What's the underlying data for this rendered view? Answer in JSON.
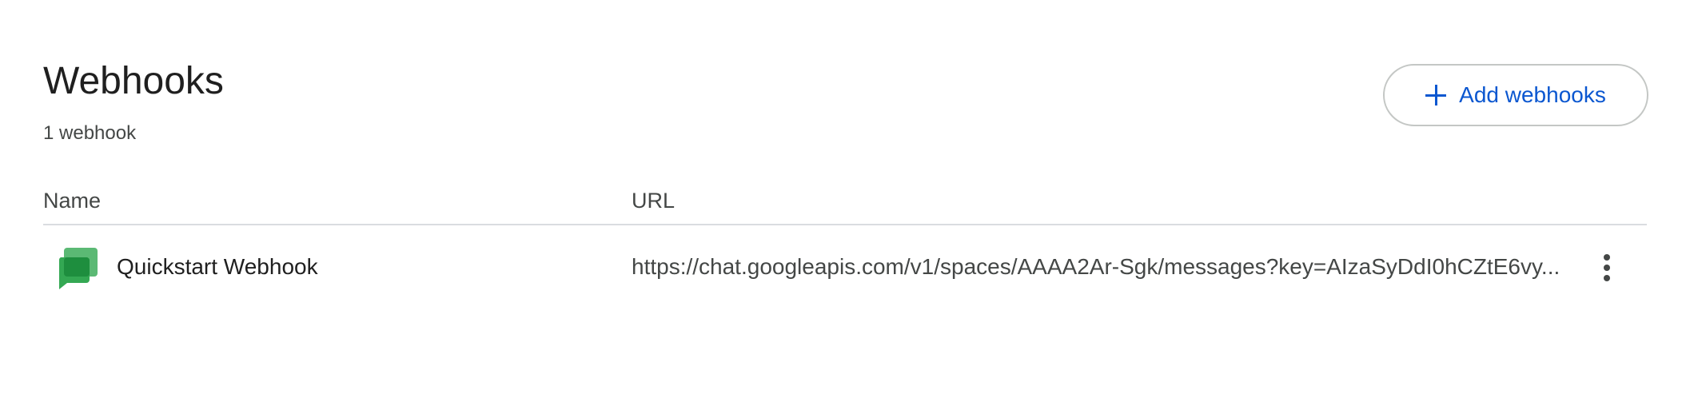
{
  "header": {
    "title": "Webhooks",
    "count_label": "1 webhook",
    "add_button_label": "Add webhooks"
  },
  "table": {
    "columns": [
      "Name",
      "URL"
    ],
    "rows": [
      {
        "icon": "google-chat-icon",
        "name": "Quickstart Webhook",
        "url": "https://chat.googleapis.com/v1/spaces/AAAA2Ar-Sgk/messages?key=AIzaSyDdI0hCZtE6vy..."
      }
    ]
  },
  "colors": {
    "accent": "#0b57d0",
    "chat_icon_light": "#5bb974",
    "chat_icon_dark": "#1e8e3e"
  }
}
